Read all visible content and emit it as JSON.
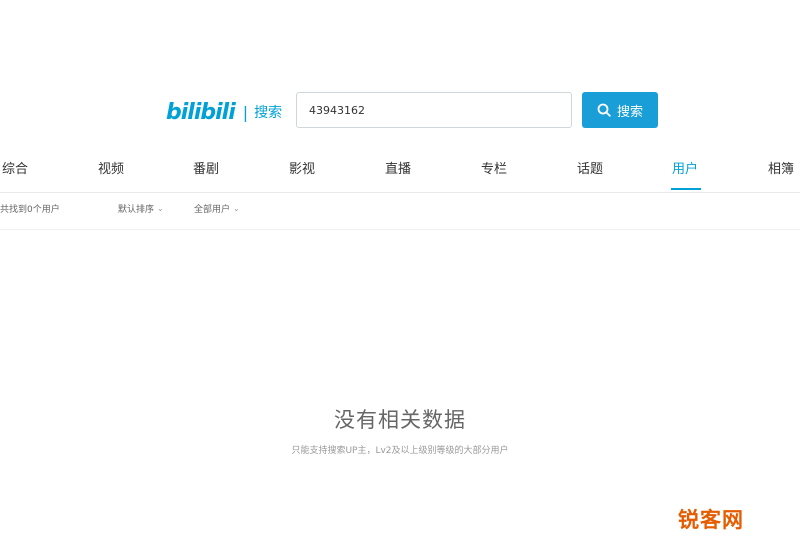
{
  "header": {
    "logo_text": "bilibili",
    "logo_suffix": "搜索",
    "search_value": "43943162",
    "search_button_label": "搜索"
  },
  "tabs": [
    {
      "label": "综合"
    },
    {
      "label": "视频"
    },
    {
      "label": "番剧"
    },
    {
      "label": "影视"
    },
    {
      "label": "直播"
    },
    {
      "label": "专栏"
    },
    {
      "label": "话题"
    },
    {
      "label": "用户",
      "active": true
    },
    {
      "label": "相簿"
    }
  ],
  "filters": {
    "count": "共找到0个用户",
    "sort": "默认排序",
    "type": "全部用户"
  },
  "empty": {
    "title": "没有相关数据",
    "subtitle": "只能支持搜索UP主，Lv2及以上级别等级的大部分用户"
  },
  "watermark": "锐客网",
  "colors": {
    "accent": "#00a1d6",
    "button": "#1a9ed8",
    "watermark": "#e65c00"
  }
}
